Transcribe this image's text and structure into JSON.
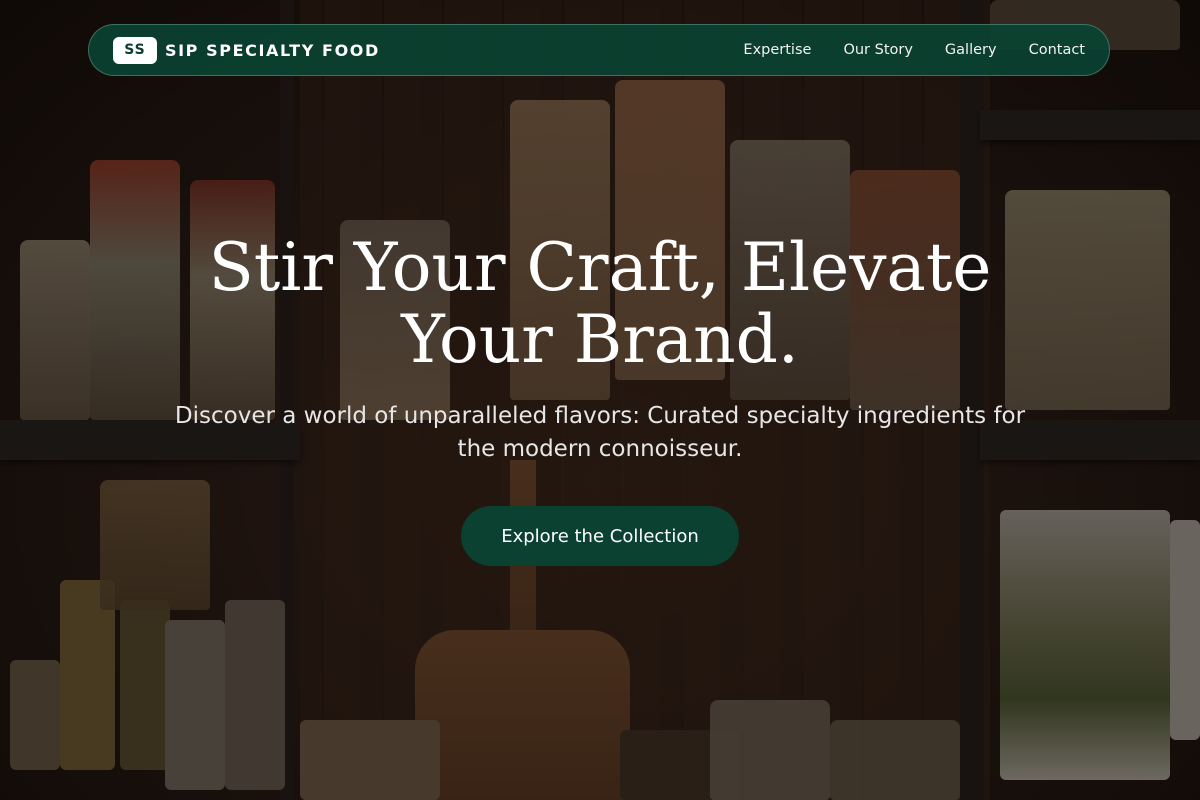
{
  "nav": {
    "logo": "SS",
    "brand": "SIP SPECIALTY FOOD",
    "links": [
      {
        "label": "Expertise"
      },
      {
        "label": "Our Story"
      },
      {
        "label": "Gallery"
      },
      {
        "label": "Contact"
      }
    ]
  },
  "hero": {
    "title": "Stir Your Craft, Elevate Your Brand.",
    "subtitle": "Discover a world of unparalleled flavors: Curated specialty ingredients for the modern connoisseur.",
    "cta": "Explore the Collection"
  },
  "colors": {
    "nav_background": "#0a4230",
    "cta_background": "#0b4130",
    "text": "#ffffff"
  }
}
